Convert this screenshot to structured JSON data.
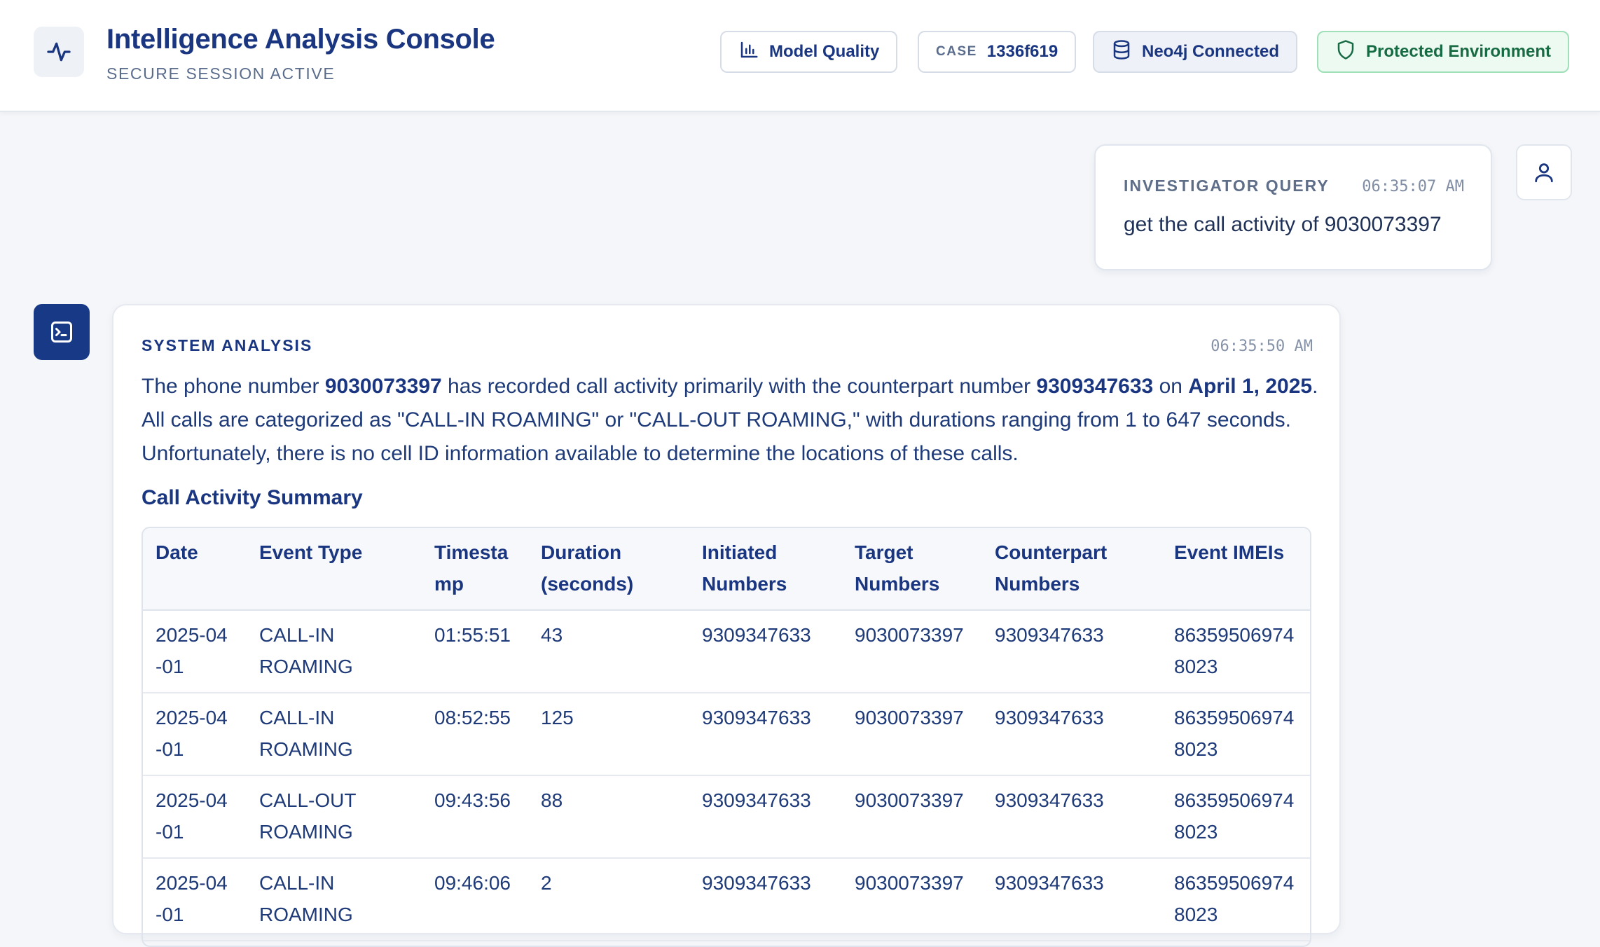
{
  "header": {
    "title": "Intelligence Analysis Console",
    "subtitle": "SECURE SESSION ACTIVE",
    "logo_icon": "activity-pulse-icon",
    "model_quality_label": "Model Quality",
    "case_label": "CASE",
    "case_id": "1336f619",
    "neo4j_label": "Neo4j Connected",
    "protected_label": "Protected Environment"
  },
  "query": {
    "label": "INVESTIGATOR QUERY",
    "time": "06:35:07 AM",
    "text": "get the call activity of 9030073397"
  },
  "response": {
    "label": "SYSTEM ANALYSIS",
    "time": "06:35:50 AM",
    "para": {
      "t1": "The phone number ",
      "b1": "9030073397",
      "t2": " has recorded call activity primarily with the counterpart number ",
      "b2": "9309347633",
      "t3": " on ",
      "b3": "April 1, 2025",
      "t4": ". All calls are categorized as \"CALL-IN ROAMING\" or \"CALL-OUT ROAMING,\" with durations ranging from 1 to 647 seconds. Unfortunately, there is no cell ID information available to determine the locations of these calls."
    },
    "section_title": "Call Activity Summary",
    "table": {
      "headers": [
        "Date",
        "Event Type",
        "Timestamp",
        "Duration (seconds)",
        "Initiated Numbers",
        "Target Numbers",
        "Counterpart Numbers",
        "Event IMEIs"
      ],
      "rows": [
        [
          "2025-04-01",
          "CALL-IN ROAMING",
          "01:55:51",
          "43",
          "9309347633",
          "9030073397",
          "9309347633",
          "863595069748023"
        ],
        [
          "2025-04-01",
          "CALL-IN ROAMING",
          "08:52:55",
          "125",
          "9309347633",
          "9030073397",
          "9309347633",
          "863595069748023"
        ],
        [
          "2025-04-01",
          "CALL-OUT ROAMING",
          "09:43:56",
          "88",
          "9309347633",
          "9030073397",
          "9309347633",
          "863595069748023"
        ],
        [
          "2025-04-01",
          "CALL-IN ROAMING",
          "09:46:06",
          "2",
          "9309347633",
          "9030073397",
          "9309347633",
          "863595069748023"
        ]
      ]
    }
  },
  "colors": {
    "brand": "#1a3680",
    "protected": "#176b43",
    "protected_bg": "#ecfaf1"
  }
}
